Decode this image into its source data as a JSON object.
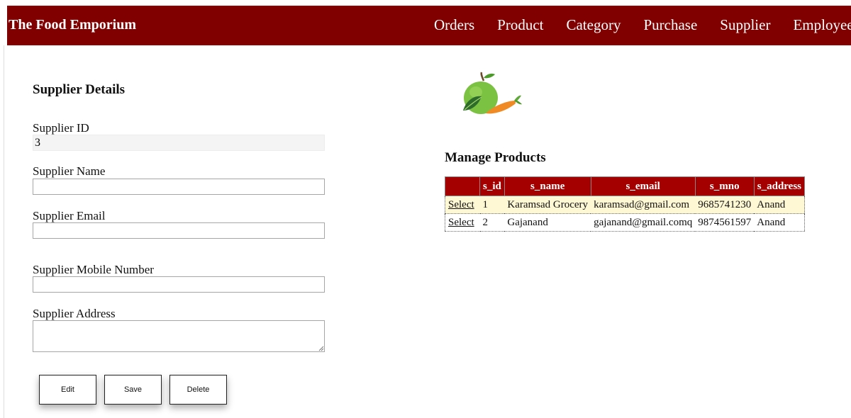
{
  "header": {
    "brand": "The Food Emporium",
    "nav": [
      "Orders",
      "Product",
      "Category",
      "Purchase",
      "Supplier",
      "Employee"
    ]
  },
  "form": {
    "title": "Supplier Details",
    "id_label": "Supplier ID",
    "id_value": "3",
    "name_label": "Supplier Name",
    "name_value": "",
    "email_label": "Supplier Email",
    "email_value": "",
    "mobile_label": "Supplier Mobile Number",
    "mobile_value": "",
    "address_label": "Supplier Address",
    "address_value": ""
  },
  "buttons": {
    "edit": "Edit",
    "save": "Save",
    "delete": "Delete"
  },
  "table": {
    "title": "Manage Products",
    "columns": [
      "",
      "s_id",
      "s_name",
      "s_email",
      "s_mno",
      "s_address"
    ],
    "rows": [
      {
        "action": "Select",
        "s_id": "1",
        "s_name": "Karamsad Grocery",
        "s_email": "karamsad@gmail.com",
        "s_mno": "9685741230",
        "s_address": "Anand"
      },
      {
        "action": "Select",
        "s_id": "2",
        "s_name": "Gajanand",
        "s_email": "gajanand@gmail.comq",
        "s_mno": "9874561597",
        "s_address": "Anand"
      }
    ]
  },
  "colors": {
    "header_bg": "#800000",
    "table_header_bg": "#a40000",
    "row_highlight": "#fff8d4"
  },
  "icons": {
    "logo": "fruit-vegetable-logo-icon"
  }
}
